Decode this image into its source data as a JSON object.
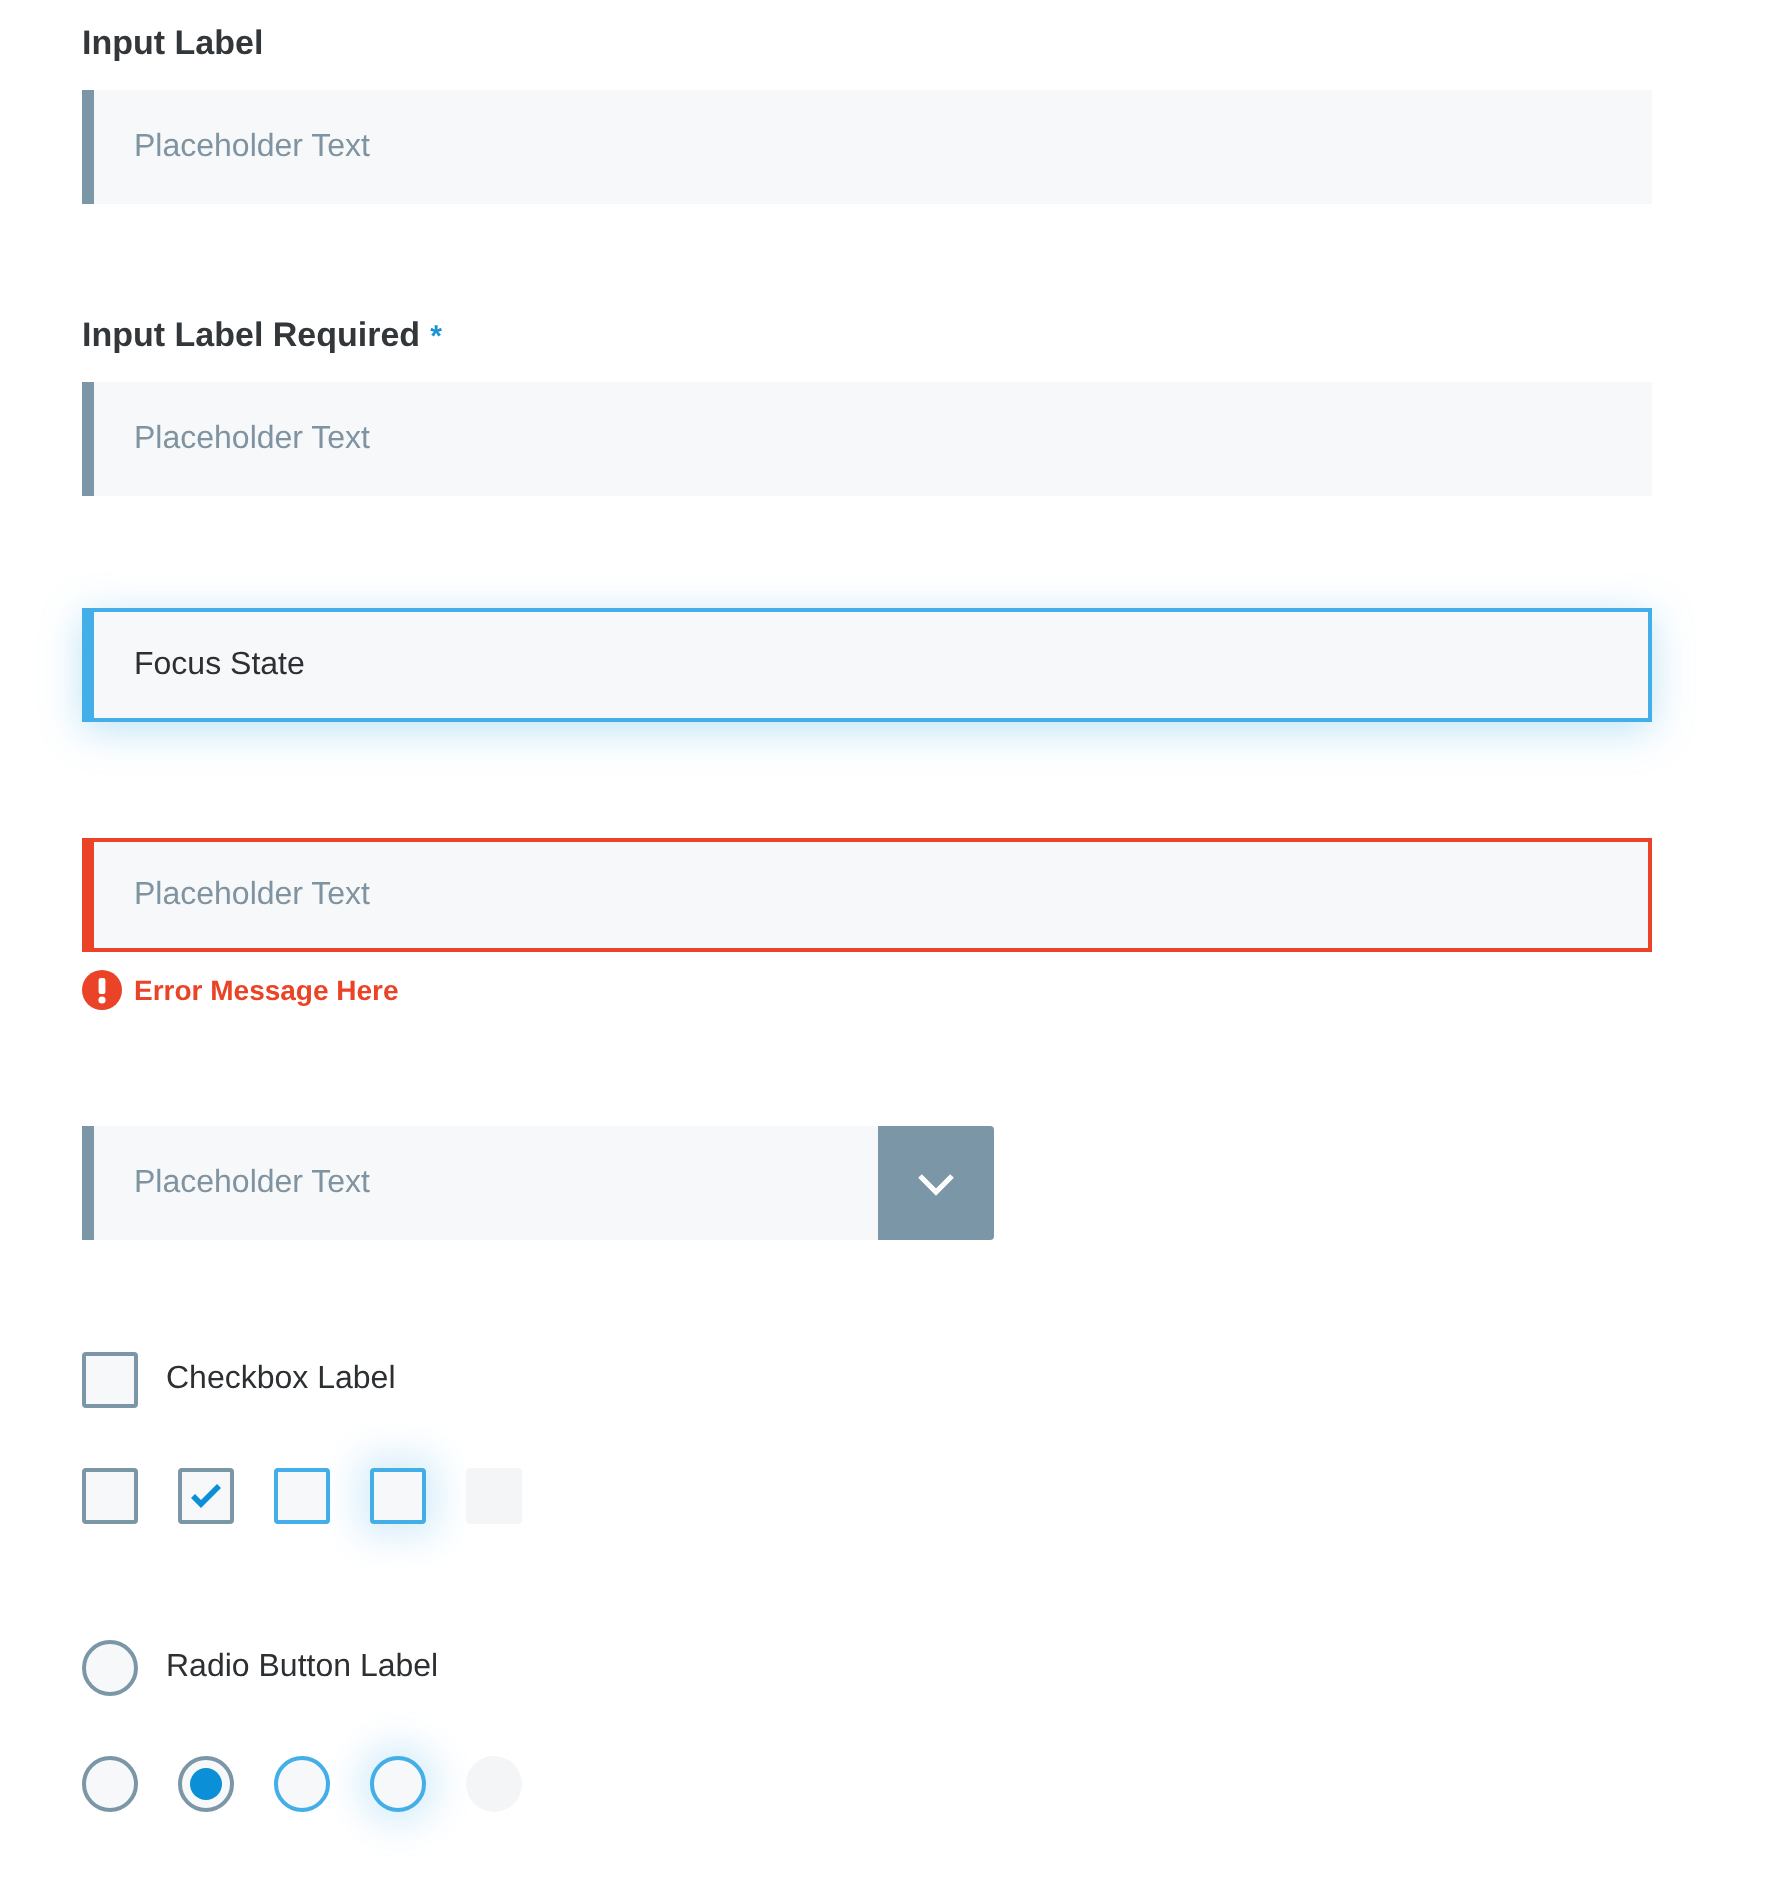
{
  "fields": [
    {
      "kind": "text",
      "label": "Input Label",
      "focused": false,
      "invalid": false,
      "placeholder": "Placeholder Text"
    },
    {
      "kind": "text",
      "label": "Input Label Required",
      "required_mark": "*",
      "focused": false,
      "invalid": false,
      "placeholder": "Placeholder Text"
    },
    {
      "kind": "text",
      "focused": true,
      "invalid": false,
      "value": "Focus State"
    },
    {
      "kind": "text",
      "focused": false,
      "invalid": true,
      "placeholder": "Placeholder Text",
      "error": "Error Message Here"
    },
    {
      "kind": "select",
      "focused": false,
      "invalid": false,
      "placeholder": "Placeholder Text"
    }
  ],
  "checkbox_label": "Checkbox Label",
  "checkbox_label_checked": false,
  "checkboxes": [
    {
      "kind": "normal",
      "checked": false
    },
    {
      "kind": "normal",
      "checked": true
    },
    {
      "kind": "hover",
      "checked": false
    },
    {
      "kind": "focus",
      "checked": false
    },
    {
      "kind": "disabled",
      "checked": false
    }
  ],
  "radio_label": "Radio Button Label",
  "radio_label_selected": false,
  "radios": [
    {
      "kind": "normal",
      "selected": false
    },
    {
      "kind": "normal",
      "selected": true
    },
    {
      "kind": "hover",
      "selected": false
    },
    {
      "kind": "focus",
      "selected": false
    },
    {
      "kind": "disabled",
      "selected": false
    }
  ]
}
